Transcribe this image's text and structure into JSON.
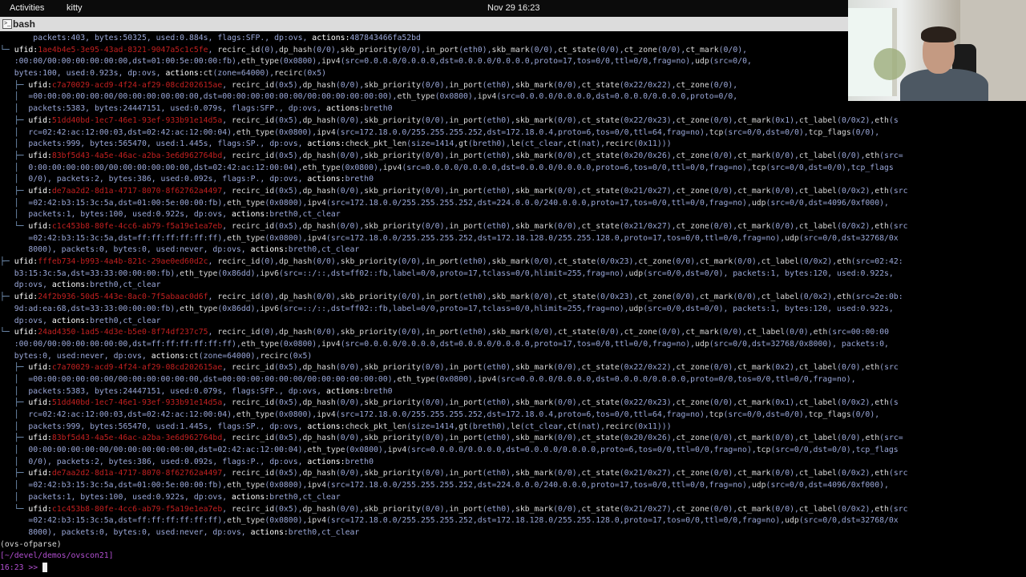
{
  "topbar": {
    "activities": "Activities",
    "app": "kitty",
    "clock": "Nov 29  16:23"
  },
  "window": {
    "title": "bash",
    "icon": "terminal-icon"
  },
  "colors": {
    "key": "#d8d8d8",
    "value": "#9aa7d8",
    "ufid": "#c22020",
    "tree": "#7fa0c8",
    "prompt": "#b14fd0"
  },
  "lines": [
    "       packets:403, bytes:50325, used:0.884s, flags:SFP., dp:ovs, actions:487843466fa52bd",
    "└─ ufid:1ae4b4e5-3e95-43ad-8321-9047a5c1c5fe, recirc_id(0),dp_hash(0/0),skb_priority(0/0),in_port(eth0),skb_mark(0/0),ct_state(0/0),ct_zone(0/0),ct_mark(0/0),",
    "   :00:00/00:00:00:00:00:00,dst=01:00:5e:00:00:fb),eth_type(0x0800),ipv4(src=0.0.0.0/0.0.0.0,dst=0.0.0.0/0.0.0.0,proto=17,tos=0/0,ttl=0/0,frag=no),udp(src=0/0,",
    "   bytes:100, used:0.923s, dp:ovs, actions:ct(zone=64000),recirc(0x5)",
    "   ├─ ufid:c7a70029-acd9-4f24-af29-08cd202615ae, recirc_id(0x5),dp_hash(0/0),skb_priority(0/0),in_port(eth0),skb_mark(0/0),ct_state(0x22/0x22),ct_zone(0/0),",
    "   │  =00:00:00:00:00:00/00:00:00:00:00:00,dst=00:00:00:00:00:00/00:00:00:00:00:00),eth_type(0x0800),ipv4(src=0.0.0.0/0.0.0.0,dst=0.0.0.0/0.0.0.0,proto=0/0,",
    "   │  packets:5383, bytes:24447151, used:0.079s, flags:SFP., dp:ovs, actions:breth0",
    "   ├─ ufid:51dd40bd-1ec7-46e1-93ef-933b91e14d5a, recirc_id(0x5),dp_hash(0/0),skb_priority(0/0),in_port(eth0),skb_mark(0/0),ct_state(0x22/0x23),ct_zone(0/0),ct_mark(0x1),ct_label(0/0x2),eth(s",
    "   │  rc=02:42:ac:12:00:03,dst=02:42:ac:12:00:04),eth_type(0x0800),ipv4(src=172.18.0.0/255.255.255.252,dst=172.18.0.4,proto=6,tos=0/0,ttl=64,frag=no),tcp(src=0/0,dst=0/0),tcp_flags(0/0),",
    "   │  packets:999, bytes:565470, used:1.445s, flags:SP., dp:ovs, actions:check_pkt_len(size=1414,gt(breth0),le(ct_clear,ct(nat),recirc(0x11)))",
    "   ├─ ufid:83bf5d43-4a5e-46ac-a2ba-3e6d962764bd, recirc_id(0x5),dp_hash(0/0),skb_priority(0/0),in_port(eth0),skb_mark(0/0),ct_state(0x20/0x26),ct_zone(0/0),ct_mark(0/0),ct_label(0/0),eth(src=",
    "   │  0:00:00:00:00:00/00:00:00:00:00:00,dst=02:42:ac:12:00:04),eth_type(0x0800),ipv4(src=0.0.0.0/0.0.0.0,dst=0.0.0.0/0.0.0.0,proto=6,tos=0/0,ttl=0/0,frag=no),tcp(src=0/0,dst=0/0),tcp_flags",
    "   │  0/0), packets:2, bytes:386, used:0.092s, flags:P., dp:ovs, actions:breth0",
    "   ├─ ufid:de7aa2d2-8d1a-4717-8070-8f62762a4497, recirc_id(0x5),dp_hash(0/0),skb_priority(0/0),in_port(eth0),skb_mark(0/0),ct_state(0x21/0x27),ct_zone(0/0),ct_mark(0/0),ct_label(0/0x2),eth(src",
    "   │  =02:42:b3:15:3c:5a,dst=01:00:5e:00:00:fb),eth_type(0x0800),ipv4(src=172.18.0.0/255.255.255.252,dst=224.0.0.0/240.0.0.0,proto=17,tos=0/0,ttl=0/0,frag=no),udp(src=0/0,dst=4096/0xf000),",
    "   │  packets:1, bytes:100, used:0.922s, dp:ovs, actions:breth0,ct_clear",
    "   └─ ufid:c1c453b8-80fe-4cc6-ab79-f5a19e1ea7eb, recirc_id(0x5),dp_hash(0/0),skb_priority(0/0),in_port(eth0),skb_mark(0/0),ct_state(0x21/0x27),ct_zone(0/0),ct_mark(0/0),ct_label(0/0x2),eth(src",
    "      =02:42:b3:15:3c:5a,dst=ff:ff:ff:ff:ff:ff),eth_type(0x0800),ipv4(src=172.18.0.0/255.255.255.252,dst=172.18.128.0/255.255.128.0,proto=17,tos=0/0,ttl=0/0,frag=no),udp(src=0/0,dst=32768/0x",
    "      8000), packets:0, bytes:0, used:never, dp:ovs, actions:breth0,ct_clear",
    "├─ ufid:fffeb734-b993-4a4b-821c-29ae0ed60d2c, recirc_id(0),dp_hash(0/0),skb_priority(0/0),in_port(eth0),skb_mark(0/0),ct_state(0/0x23),ct_zone(0/0),ct_mark(0/0),ct_label(0/0x2),eth(src=02:42:",
    "   b3:15:3c:5a,dst=33:33:00:00:00:fb),eth_type(0x86dd),ipv6(src=::/::,dst=ff02::fb,label=0/0,proto=17,tclass=0/0,hlimit=255,frag=no),udp(src=0/0,dst=0/0), packets:1, bytes:120, used:0.922s,",
    "   dp:ovs, actions:breth0,ct_clear",
    "├─ ufid:24f2b936-50d5-443e-8ac0-7f5abaac0d6f, recirc_id(0),dp_hash(0/0),skb_priority(0/0),in_port(eth0),skb_mark(0/0),ct_state(0/0x23),ct_zone(0/0),ct_mark(0/0),ct_label(0/0x2),eth(src=2e:0b:",
    "   9d:ad:ea:68,dst=33:33:00:00:00:fb),eth_type(0x86dd),ipv6(src=::/::,dst=ff02::fb,label=0/0,proto=17,tclass=0/0,hlimit=255,frag=no),udp(src=0/0,dst=0/0), packets:1, bytes:120, used:0.922s,",
    "   dp:ovs, actions:breth0,ct_clear",
    "└─ ufid:24ad4350-1ad5-4d3e-b5e0-8f74df237c75, recirc_id(0),dp_hash(0/0),skb_priority(0/0),in_port(eth0),skb_mark(0/0),ct_state(0/0),ct_zone(0/0),ct_mark(0/0),ct_label(0/0),eth(src=00:00:00",
    "   :00:00/00:00:00:00:00:00,dst=ff:ff:ff:ff:ff:ff),eth_type(0x0800),ipv4(src=0.0.0.0/0.0.0.0,dst=0.0.0.0/0.0.0.0,proto=17,tos=0/0,ttl=0/0,frag=no),udp(src=0/0,dst=32768/0x8000), packets:0,",
    "   bytes:0, used:never, dp:ovs, actions:ct(zone=64000),recirc(0x5)",
    "   ├─ ufid:c7a70029-acd9-4f24-af29-08cd202615ae, recirc_id(0x5),dp_hash(0/0),skb_priority(0/0),in_port(eth0),skb_mark(0/0),ct_state(0x22/0x22),ct_zone(0/0),ct_mark(0x2),ct_label(0/0),eth(src",
    "   │  =00:00:00:00:00:00/00:00:00:00:00:00,dst=00:00:00:00:00:00/00:00:00:00:00:00),eth_type(0x0800),ipv4(src=0.0.0.0/0.0.0.0,dst=0.0.0.0/0.0.0.0,proto=0/0,tos=0/0,ttl=0/0,frag=no),",
    "   │  packets:5383, bytes:24447151, used:0.079s, flags:SFP., dp:ovs, actions:breth0",
    "   ├─ ufid:51dd40bd-1ec7-46e1-93ef-933b91e14d5a, recirc_id(0x5),dp_hash(0/0),skb_priority(0/0),in_port(eth0),skb_mark(0/0),ct_state(0x22/0x23),ct_zone(0/0),ct_mark(0x1),ct_label(0/0x2),eth(s",
    "   │  rc=02:42:ac:12:00:03,dst=02:42:ac:12:00:04),eth_type(0x0800),ipv4(src=172.18.0.0/255.255.255.252,dst=172.18.0.4,proto=6,tos=0/0,ttl=64,frag=no),tcp(src=0/0,dst=0/0),tcp_flags(0/0),",
    "   │  packets:999, bytes:565470, used:1.445s, flags:SP., dp:ovs, actions:check_pkt_len(size=1414,gt(breth0),le(ct_clear,ct(nat),recirc(0x11)))",
    "   ├─ ufid:83bf5d43-4a5e-46ac-a2ba-3e6d962764bd, recirc_id(0x5),dp_hash(0/0),skb_priority(0/0),in_port(eth0),skb_mark(0/0),ct_state(0x20/0x26),ct_zone(0/0),ct_mark(0/0),ct_label(0/0),eth(src=",
    "   │  00:00:00:00:00:00/00:00:00:00:00:00,dst=02:42:ac:12:00:04),eth_type(0x0800),ipv4(src=0.0.0.0/0.0.0.0,dst=0.0.0.0/0.0.0.0,proto=6,tos=0/0,ttl=0/0,frag=no),tcp(src=0/0,dst=0/0),tcp_flags",
    "   │  0/0), packets:2, bytes:386, used:0.092s, flags:P., dp:ovs, actions:breth0",
    "   ├─ ufid:de7aa2d2-8d1a-4717-8070-8f62762a4497, recirc_id(0x5),dp_hash(0/0),skb_priority(0/0),in_port(eth0),skb_mark(0/0),ct_state(0x21/0x27),ct_zone(0/0),ct_mark(0/0),ct_label(0/0x2),eth(src",
    "   │  =02:42:b3:15:3c:5a,dst=01:00:5e:00:00:fb),eth_type(0x0800),ipv4(src=172.18.0.0/255.255.255.252,dst=224.0.0.0/240.0.0.0,proto=17,tos=0/0,ttl=0/0,frag=no),udp(src=0/0,dst=4096/0xf000),",
    "   │  packets:1, bytes:100, used:0.922s, dp:ovs, actions:breth0,ct_clear",
    "   └─ ufid:c1c453b8-80fe-4cc6-ab79-f5a19e1ea7eb, recirc_id(0x5),dp_hash(0/0),skb_priority(0/0),in_port(eth0),skb_mark(0/0),ct_state(0x21/0x27),ct_zone(0/0),ct_mark(0/0),ct_label(0/0x2),eth(src",
    "      =02:42:b3:15:3c:5a,dst=ff:ff:ff:ff:ff:ff),eth_type(0x0800),ipv4(src=172.18.0.0/255.255.255.252,dst=172.18.128.0/255.255.128.0,proto=17,tos=0/0,ttl=0/0,frag=no),udp(src=0/0,dst=32768/0x",
    "      8000), packets:0, bytes:0, used:never, dp:ovs, actions:breth0,ct_clear"
  ],
  "env": "(ovs-ofparse)",
  "cwd": "[~/devel/demos/ovscon21]",
  "prompt": {
    "time": "16:23",
    "arrow": ">>"
  }
}
